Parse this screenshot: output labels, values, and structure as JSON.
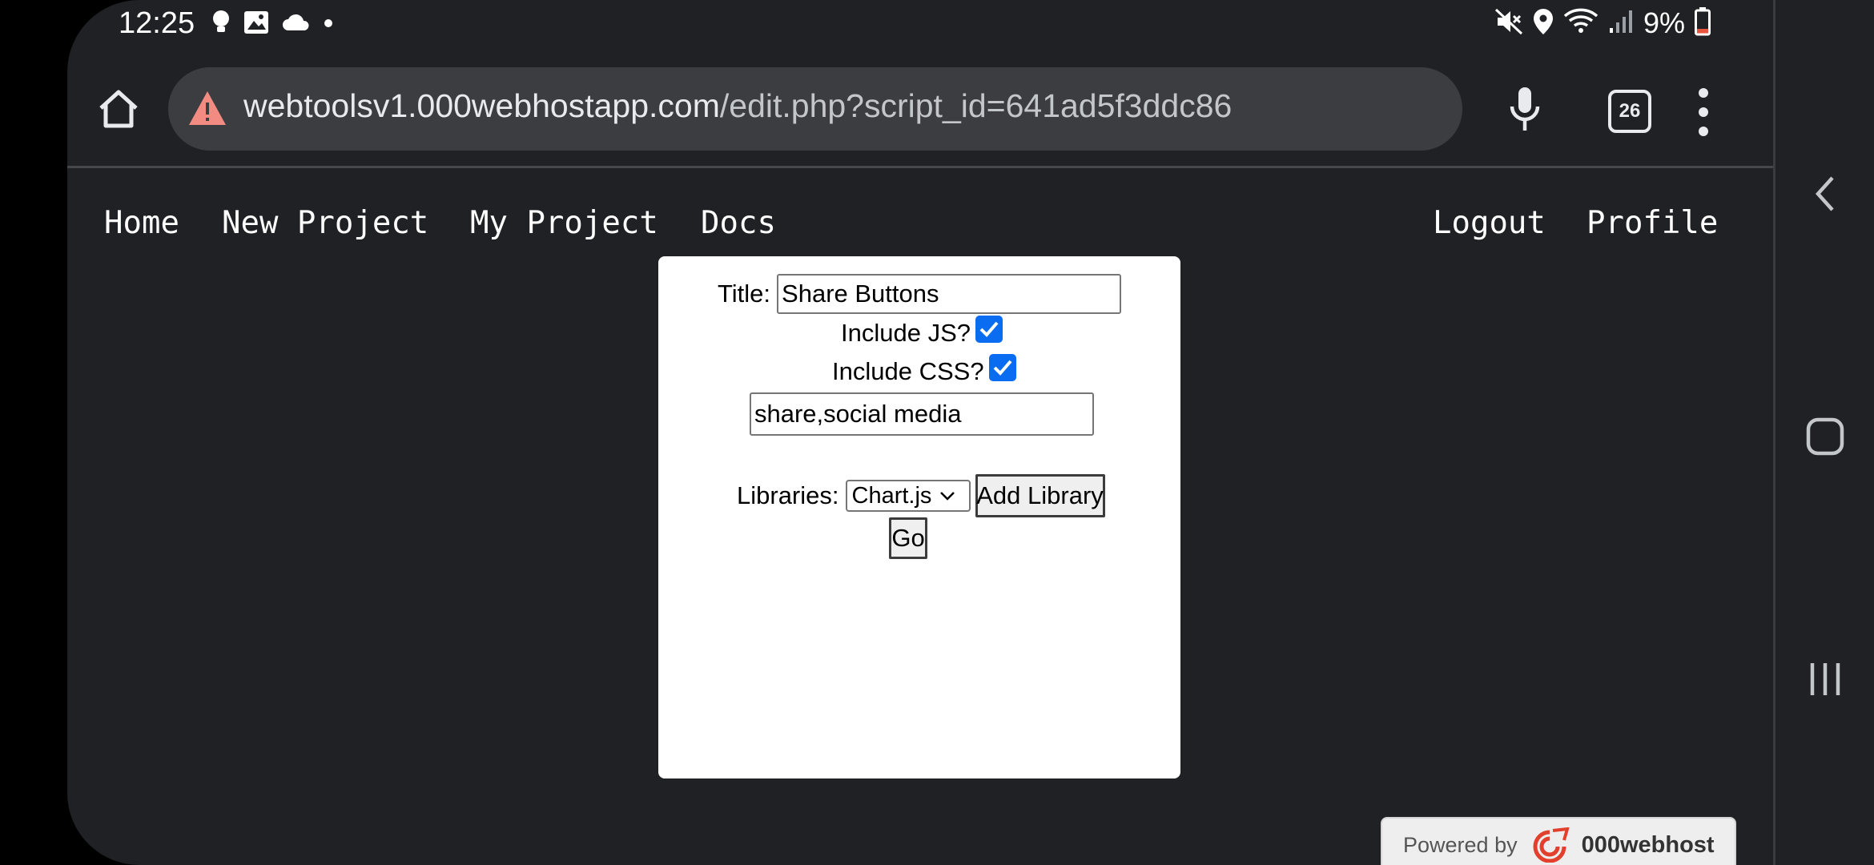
{
  "status_bar": {
    "time": "12:25",
    "battery": "9%",
    "left_icons": [
      "bulb-icon",
      "image-icon",
      "cloud-icon",
      "dot-icon"
    ],
    "right_icons": [
      "mute-icon",
      "location-icon",
      "wifi-icon",
      "signal-icon",
      "battery-icon"
    ],
    "battery_color": "#e8553f"
  },
  "browser": {
    "url_domain": "webtoolsv1.000webhostapp.com",
    "url_path": "/edit.php?script_id=641ad5f3ddc86",
    "tab_count": "26",
    "warning_color": "#f28b82"
  },
  "site_nav": {
    "home": "Home",
    "new_project": "New Project",
    "my_project": "My Project",
    "docs": "Docs",
    "logout": "Logout",
    "profile": "Profile"
  },
  "form": {
    "title_label": "Title:",
    "title_value": "Share Buttons",
    "include_js_label": "Include JS?",
    "include_js_checked": true,
    "include_css_label": "Include CSS?",
    "include_css_checked": true,
    "tags_value": "share,social media",
    "libraries_label": "Libraries:",
    "library_selected": "Chart.js",
    "add_library_label": "Add Library",
    "go_label": "Go",
    "checkbox_color": "#0a6cf0"
  },
  "footer": {
    "powered_by": "Powered by",
    "brand": "000webhost",
    "brand_color": "#e2402c"
  }
}
